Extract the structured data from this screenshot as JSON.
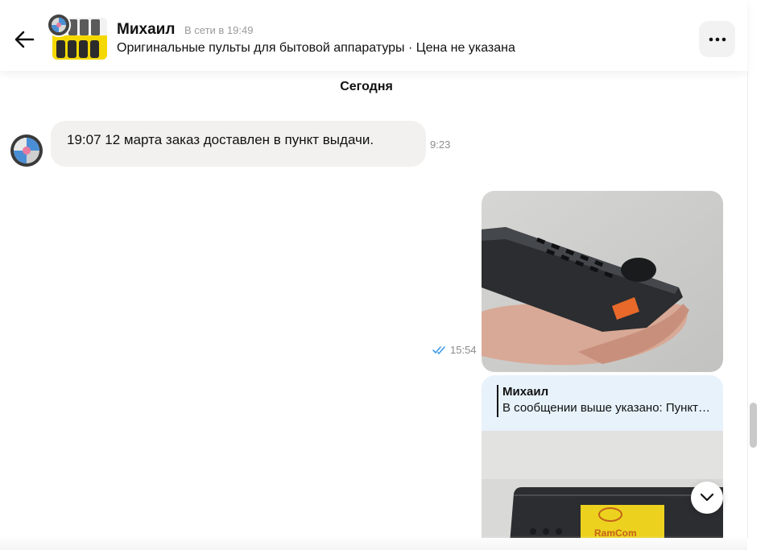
{
  "header": {
    "contact_name": "Михаил",
    "status": "В сети в 19:49",
    "ad_title": "Оригинальные пульты для бытовой аппаратуры · Цена не указана"
  },
  "chat": {
    "date_separator": "Сегодня",
    "messages": [
      {
        "direction": "incoming",
        "text": "19:07 12 марта заказ доставлен в пункт выдачи.",
        "time": "9:23"
      },
      {
        "direction": "outgoing",
        "type": "image",
        "time": "15:54",
        "read": true
      },
      {
        "direction": "outgoing",
        "type": "image-with-reply",
        "reply": {
          "author": "Михаил",
          "text": "В сообщении выше указано: Пункт выдачи"
        }
      }
    ]
  },
  "photo2": {
    "brand_label": "RamCom"
  },
  "icons": {
    "back": "arrow-left-icon",
    "more": "ellipsis-icon",
    "read": "double-check-icon",
    "scroll_down": "chevron-down-icon"
  },
  "colors": {
    "bubble_incoming": "#f2f1f0",
    "reply_card": "#e7f2fb",
    "read_check": "#3c9be8",
    "more_button": "#f2f2f2"
  }
}
